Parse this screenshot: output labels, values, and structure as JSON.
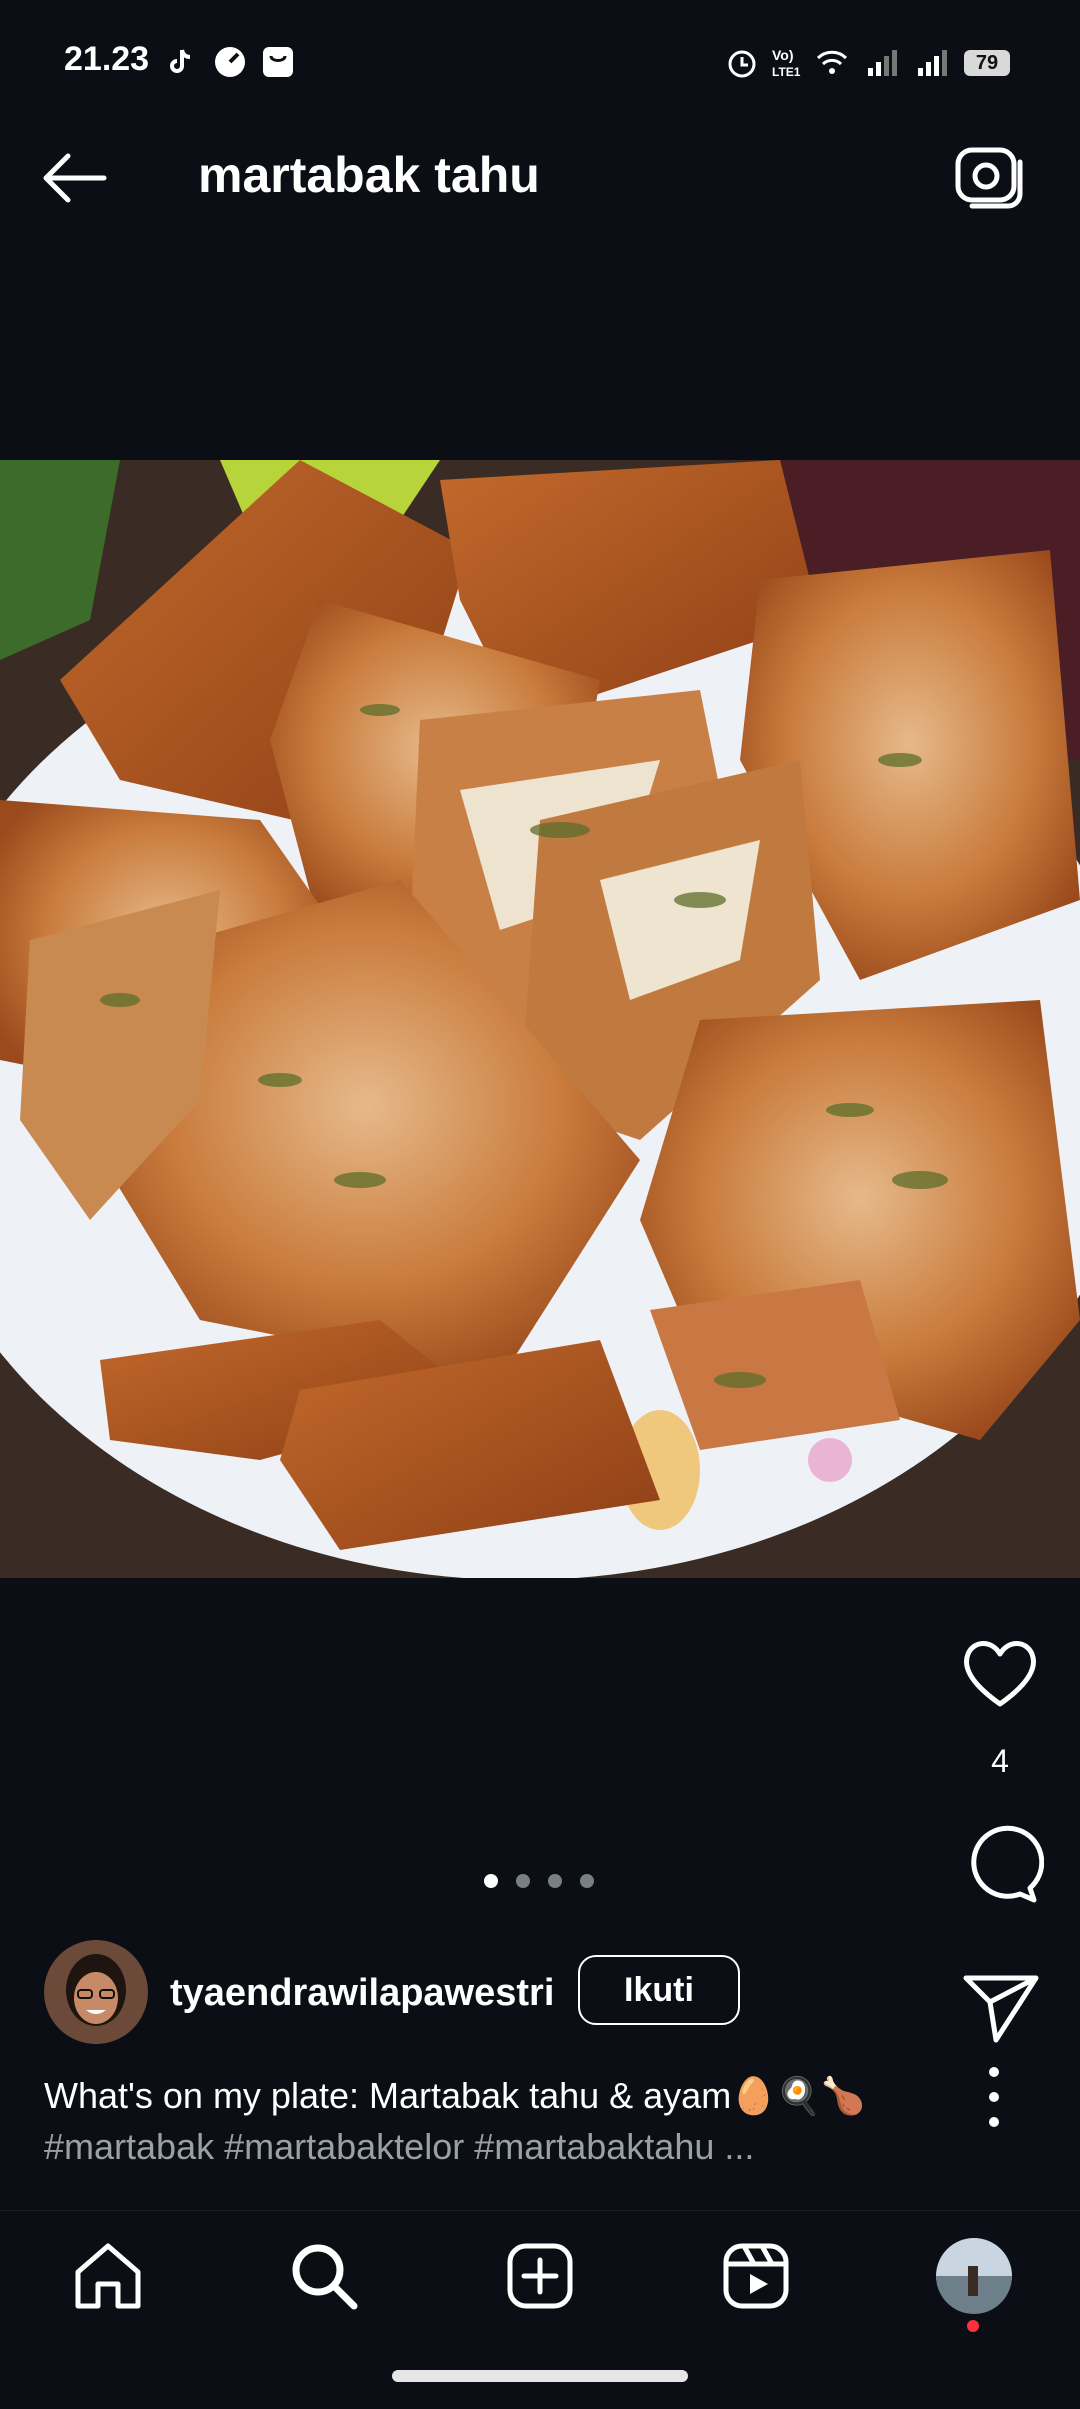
{
  "status_bar": {
    "time": "21.23",
    "battery": "79"
  },
  "header": {
    "title": "martabak tahu"
  },
  "post": {
    "like_count": "4",
    "username": "tyaendrawilapawestri",
    "follow_label": "Ikuti",
    "caption_line1": "What's on my plate: Martabak tahu & ayam🥚🍳🍗",
    "caption_line2": "#martabak #martabaktelor #martabaktahu ...",
    "carousel": {
      "count": 4,
      "active_index": 0
    }
  },
  "icons": {
    "status": [
      "tiktok-icon",
      "speed-icon",
      "bag-icon",
      "alarm-icon",
      "volte-icon",
      "wifi-icon",
      "signal-icon",
      "signal-icon",
      "battery-icon"
    ],
    "header": [
      "back-arrow-icon",
      "camera-icon"
    ],
    "actions": [
      "heart-icon",
      "comment-icon",
      "share-icon",
      "more-icon"
    ],
    "nav": [
      "home-icon",
      "search-icon",
      "add-icon",
      "reels-icon",
      "profile-avatar"
    ]
  },
  "colors": {
    "background": "#0b0f15",
    "text": "#ffffff",
    "muted": "#9aa0a6",
    "notification_dot": "#ff3040"
  }
}
